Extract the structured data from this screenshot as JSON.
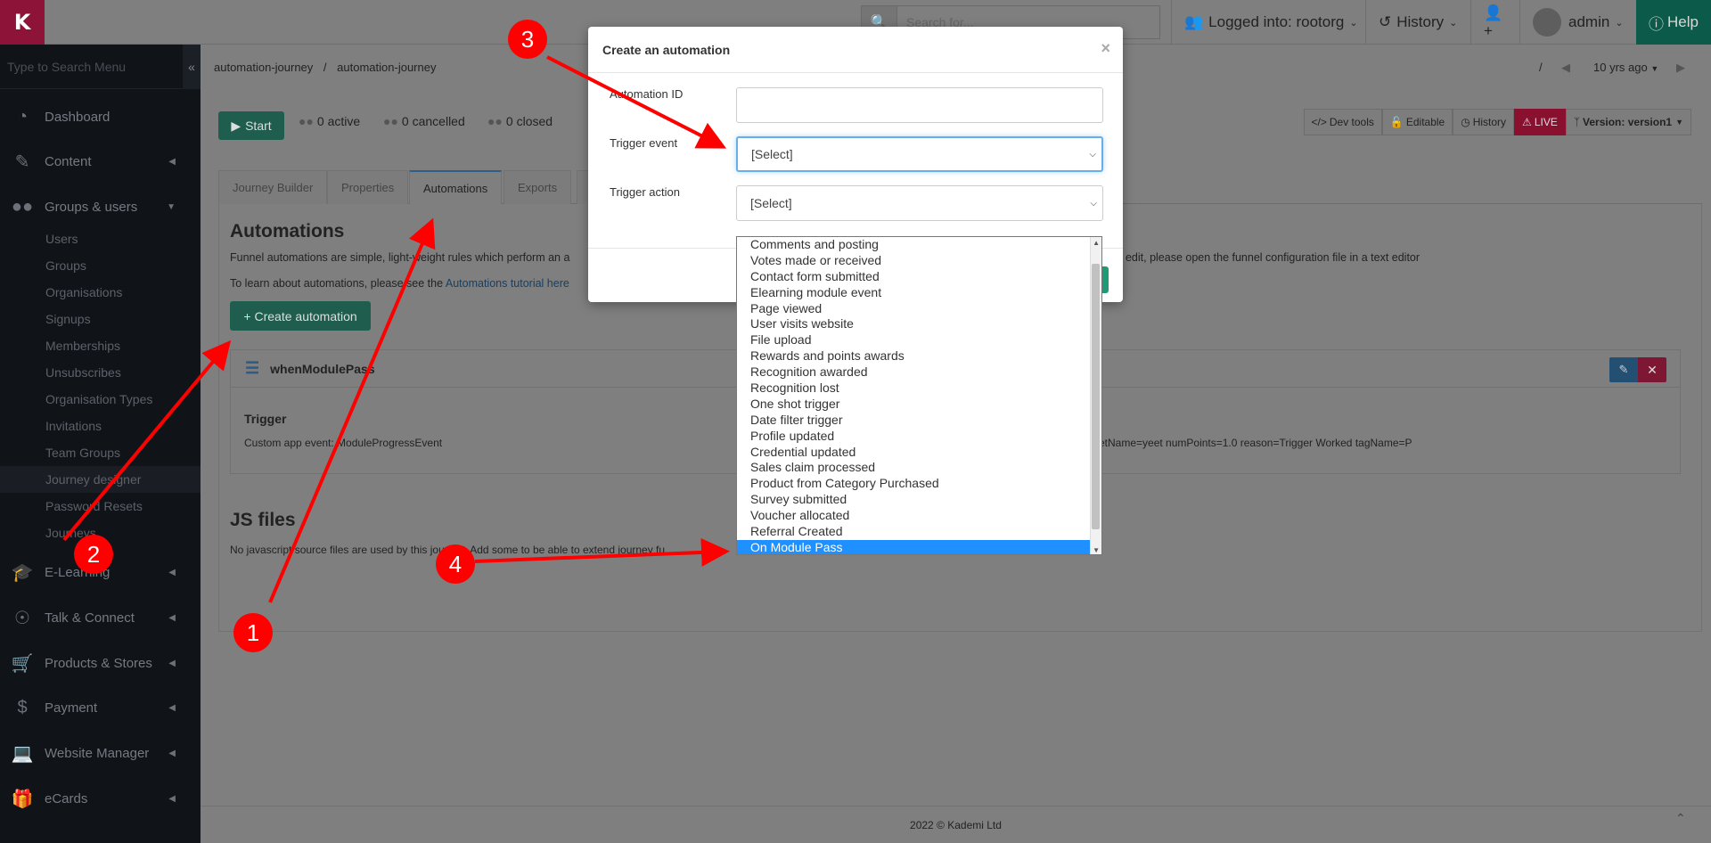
{
  "topbar": {
    "logo": "K",
    "search_placeholder": "Search for...",
    "logged_in": "Logged into: rootorg",
    "history": "History",
    "user": "admin",
    "help": "Help"
  },
  "sidebar": {
    "search_placeholder": "Type to Search Menu",
    "collapse": "«",
    "items": [
      {
        "label": "Dashboard",
        "icon": "dashboard-icon"
      },
      {
        "label": "Content",
        "icon": "edit-icon"
      },
      {
        "label": "Groups & users",
        "icon": "users-icon"
      },
      {
        "label": "E-Learning",
        "icon": "graduation-cap-icon"
      },
      {
        "label": "Talk & Connect",
        "icon": "rss-icon"
      },
      {
        "label": "Products & Stores",
        "icon": "cart-icon"
      },
      {
        "label": "Payment",
        "icon": "dollar-icon"
      },
      {
        "label": "Website Manager",
        "icon": "monitor-icon"
      },
      {
        "label": "eCards",
        "icon": "gift-icon"
      }
    ],
    "sub_items": [
      "Users",
      "Groups",
      "Organisations",
      "Signups",
      "Memberships",
      "Unsubscribes",
      "Organisation Types",
      "Invitations",
      "Team Groups",
      "Journey designer",
      "Password Resets",
      "Journeys"
    ]
  },
  "breadcrumb": {
    "first": "automation-journey",
    "second": "automation-journey",
    "sep": "/",
    "time": "10 yrs ago"
  },
  "toolbar": {
    "start": "Start",
    "active": "0 active",
    "cancelled": "0 cancelled",
    "closed": "0 closed",
    "devtools": "Dev tools",
    "editable": "Editable",
    "history": "History",
    "live": "LIVE",
    "version": "Version: version1"
  },
  "tabs": [
    "Journey Builder",
    "Properties",
    "Automations",
    "Exports",
    "E"
  ],
  "content": {
    "title": "Automations",
    "desc_start": "Funnel automations are simple, light-weight rules which perform an a",
    "desc_end": "dd or edit, please open the funnel configuration file in a text editor",
    "learn_prefix": "To learn about automations, please see the",
    "learn_link": "Automations tutorial here",
    "create_btn": "Create automation",
    "automation_name": "whenModulePass",
    "trigger_heading": "Trigger",
    "trigger_value": "Custom app event: ModuleProgressEvent",
    "trigger_extra": "etName=yeet numPoints=1.0 reason=Trigger Worked tagName=P",
    "js_title": "JS files",
    "js_desc": "No javascript source files are used by this journey. Add some to be able to extend journey fu"
  },
  "footer": {
    "copyright": "2022 © Kademi Ltd"
  },
  "modal": {
    "title": "Create an automation",
    "close": "×",
    "id_label": "Automation ID",
    "id_value": "",
    "event_label": "Trigger event",
    "event_value": "[Select]",
    "action_label": "Trigger action",
    "action_value": "[Select]"
  },
  "dropdown": {
    "options": [
      "Comments and posting",
      "Votes made or received",
      "Contact form submitted",
      "Elearning module event",
      "Page viewed",
      "User visits website",
      "File upload",
      "Rewards and points awards",
      "Recognition awarded",
      "Recognition lost",
      "One shot trigger",
      "Date filter trigger",
      "Profile updated",
      "Credential updated",
      "Sales claim processed",
      "Product from Category Purchased",
      "Survey submitted",
      "Voucher allocated",
      "Referral Created",
      "On Module Pass"
    ],
    "selected": "On Module Pass"
  },
  "markers": [
    "1",
    "2",
    "3",
    "4"
  ],
  "colors": {
    "annotation": "#ff0000",
    "selected_option": "#1e90ff",
    "live": "#8a1030",
    "primary_btn": "#1f5e4e"
  }
}
